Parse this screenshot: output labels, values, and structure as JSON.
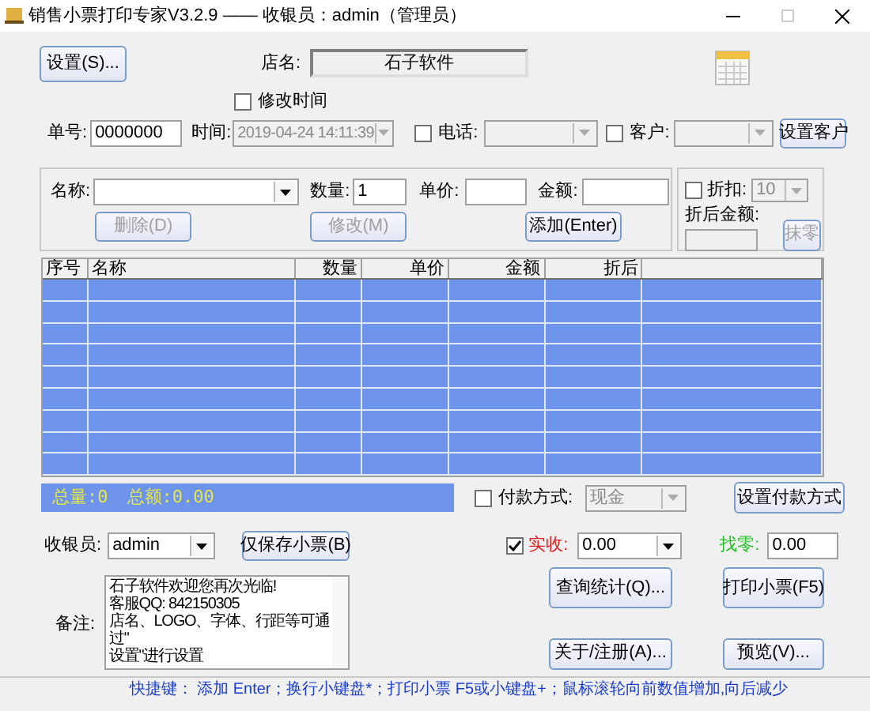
{
  "window": {
    "title": "销售小票打印专家V3.2.9 —— 收银员：admin（管理员）"
  },
  "settings_button": "设置(S)...",
  "shop_name": {
    "label": "店名:",
    "value": "石子软件"
  },
  "edit_time": {
    "label": "修改时间",
    "checked": false
  },
  "order_no": {
    "label": "单号:",
    "value": "0000000"
  },
  "time": {
    "label": "时间:",
    "value": "2019-04-24 14:11:39",
    "disabled": true
  },
  "phone": {
    "label": "电话:",
    "checked": false
  },
  "customer": {
    "label": "客户:",
    "checked": false
  },
  "set_customer_button": "设置客户",
  "item_entry": {
    "name_label": "名称:",
    "qty_label": "数量:",
    "qty": "1",
    "price_label": "单价:",
    "amount_label": "金额:",
    "buttons": [
      {
        "label": "删除(D)",
        "disabled": true
      },
      {
        "label": "修改(M)",
        "disabled": true
      },
      {
        "label": "添加(Enter)",
        "disabled": false
      }
    ]
  },
  "discount": {
    "label": "折扣:",
    "checked": false,
    "value": "10",
    "after_label": "折后金额:",
    "round_button": {
      "label": "抹零",
      "disabled": true
    }
  },
  "table": {
    "columns": [
      "序号",
      "名称",
      "数量",
      "单价",
      "金额",
      "折后"
    ]
  },
  "summary": {
    "total_qty": "总量:0",
    "total_amount": "总额:0.00"
  },
  "payment": {
    "label": "付款方式:",
    "checked": false,
    "value": "现金"
  },
  "set_payment_button": "设置付款方式",
  "cashier": {
    "label": "收银员:",
    "value": "admin"
  },
  "save_only_button": "仅保存小票(B)",
  "received": {
    "label": "实收:",
    "checked": true,
    "value": "0.00"
  },
  "change": {
    "label": "找零:",
    "value": "0.00"
  },
  "note": {
    "label": "备注:",
    "value": "石子软件欢迎您再次光临!\n客服QQ: 842150305\n店名、LOGO、字体、行距等可通过\"\n设置\"进行设置"
  },
  "action_buttons": [
    "查询统计(Q)...",
    "打印小票(F5)",
    "关于/注册(A)...",
    "预览(V)..."
  ],
  "footer": "快捷键： 添加 Enter；换行小键盘*；打印小票 F5或小键盘+；鼠标滚轮向前数值增加,向后减少"
}
